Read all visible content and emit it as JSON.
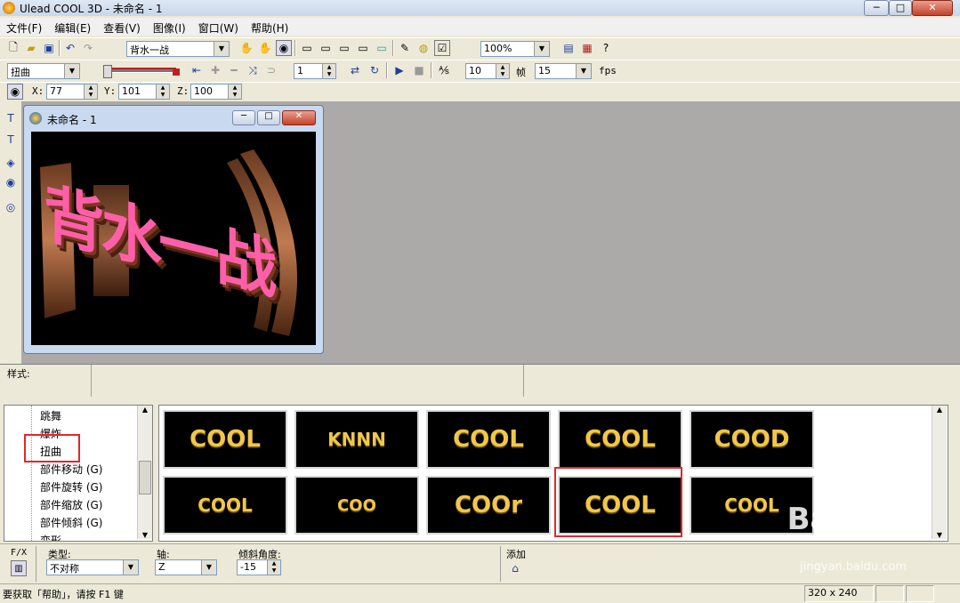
{
  "window": {
    "title": "Ulead COOL 3D - 未命名 - 1",
    "min": "─",
    "max": "□",
    "close": "✕"
  },
  "menu": [
    "文件(F)",
    "编辑(E)",
    "查看(V)",
    "图像(I)",
    "窗口(W)",
    "帮助(H)"
  ],
  "toolbar1": {
    "text_object": "背水一战",
    "zoom": "100%"
  },
  "toolbar2": {
    "effect_select": "扭曲",
    "frame_current": "1",
    "frames_total_label": "帧",
    "frames_value": "10",
    "fps_value": "15",
    "fps_label": "fps"
  },
  "toolbar3": {
    "x_label": "X:",
    "x_value": "77",
    "y_label": "Y:",
    "y_value": "101",
    "z_label": "Z:",
    "z_value": "100"
  },
  "document": {
    "title": "未命名 - 1",
    "canvas_text": "背水一战"
  },
  "stylebar": {
    "label": "样式:"
  },
  "tree": {
    "items": [
      "跳舞",
      "爆炸",
      "扭曲",
      "部件移动 (G)",
      "部件旋转 (G)",
      "部件缩放 (G)",
      "部件倾斜 (G)",
      "变形"
    ],
    "selected_index": 2
  },
  "thumbnails": [
    "COOL",
    "KNNN",
    "COOL",
    "COOL",
    "COOD",
    "COOL",
    "COO",
    "COOr",
    "COOL",
    "COOL"
  ],
  "thumbnail_selected_index": 8,
  "attributes": {
    "fx_label": "F/X",
    "type_label": "类型:",
    "type_value": "不对称",
    "axis_label": "轴:",
    "axis_value": "Z",
    "angle_label": "倾斜角度:",
    "angle_value": "-15",
    "add_label": "添加"
  },
  "status": {
    "help_text": "要获取「帮助」，请按 F1 键",
    "size": "320 x 240"
  },
  "watermark": {
    "brand": "Bai 经验",
    "url": "jingyan.baidu.com"
  },
  "colors": {
    "highlight_red": "#e0282a",
    "canvas_bg": "#000000",
    "mdi_bg": "#abaaa9",
    "thumb_text": "#f0c74a"
  }
}
